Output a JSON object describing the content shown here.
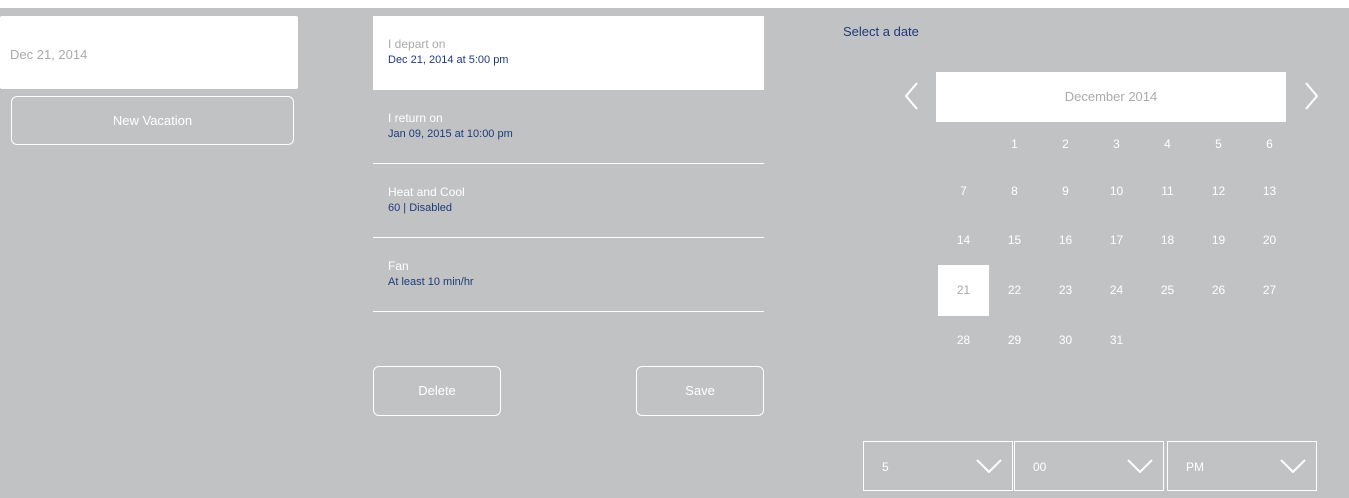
{
  "vacation_list": {
    "selected_item": "Dec 21, 2014",
    "new_button": "New Vacation"
  },
  "settings": [
    {
      "label": "I depart on",
      "value": "Dec 21, 2014 at 5:00 pm"
    },
    {
      "label": "I return on",
      "value": "Jan 09, 2015 at 10:00 pm"
    },
    {
      "label": "Heat and Cool",
      "value": "60 | Disabled"
    },
    {
      "label": "Fan",
      "value": "At least 10 min/hr"
    }
  ],
  "actions": {
    "delete": "Delete",
    "save": "Save"
  },
  "calendar": {
    "heading": "Select a date",
    "month": "December 2014",
    "selected_day": 21,
    "days": [
      "1",
      "2",
      "3",
      "4",
      "5",
      "6",
      "7",
      "8",
      "9",
      "10",
      "11",
      "12",
      "13",
      "14",
      "15",
      "16",
      "17",
      "18",
      "19",
      "20",
      "21",
      "22",
      "23",
      "24",
      "25",
      "26",
      "27",
      "28",
      "29",
      "30",
      "31"
    ],
    "prev_icon": "chevron-left-icon",
    "next_icon": "chevron-right-icon"
  },
  "time": {
    "hour": "5",
    "minute": "00",
    "ampm": "PM"
  },
  "colors": {
    "background": "#c1c2c4",
    "accent_text": "#1f3a7a",
    "muted_text": "#a9aaac",
    "white": "#ffffff"
  }
}
